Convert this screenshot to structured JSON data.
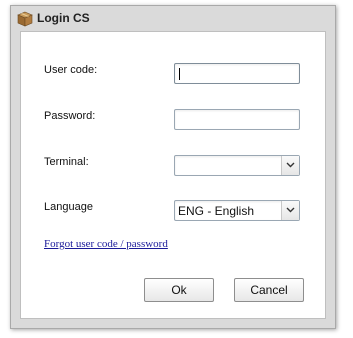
{
  "window": {
    "title": "Login CS",
    "icon": "box-icon"
  },
  "form": {
    "user_code_label": "User code:",
    "user_code_value": "",
    "password_label": "Password:",
    "password_value": "",
    "terminal_label": "Terminal:",
    "terminal_value": "",
    "language_label": "Language",
    "language_value": "ENG - English",
    "forgot_link": "Forgot user code / password"
  },
  "buttons": {
    "ok_label": "Ok",
    "cancel_label": "Cancel"
  },
  "colors": {
    "link": "#1a1a99",
    "frame": "#dadada"
  }
}
